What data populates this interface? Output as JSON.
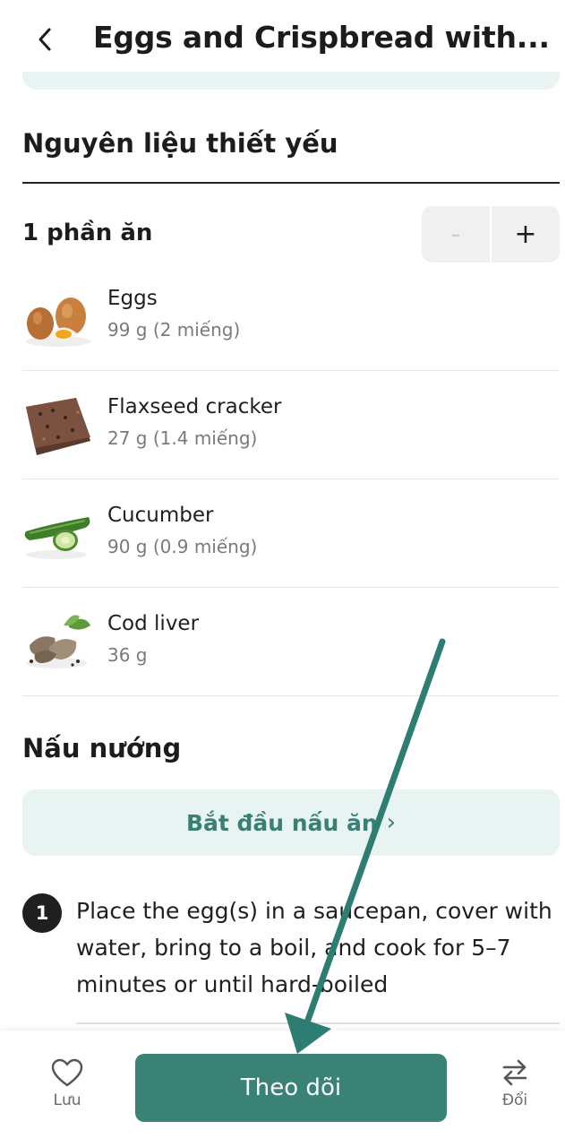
{
  "header": {
    "title": "Eggs and Crispbread with..."
  },
  "ingredients_section": {
    "title": "Nguyên liệu thiết yếu",
    "servings_label": "1 phần ăn",
    "minus_label": "-",
    "plus_label": "+",
    "items": [
      {
        "name": "Eggs",
        "quantity": "99 g (2 miếng)",
        "icon": "eggs-image"
      },
      {
        "name": "Flaxseed cracker",
        "quantity": "27 g (1.4 miếng)",
        "icon": "cracker-image"
      },
      {
        "name": "Cucumber",
        "quantity": "90 g (0.9 miếng)",
        "icon": "cucumber-image"
      },
      {
        "name": "Cod liver",
        "quantity": "36 g",
        "icon": "cod-liver-image"
      }
    ]
  },
  "cooking_section": {
    "title": "Nấu nướng",
    "start_button_label": "Bắt đầu nấu ăn",
    "steps": [
      {
        "number": "1",
        "text": "Place the egg(s) in a saucepan, cover with water, bring to a boil, and cook for 5–7 minutes or until hard-boiled"
      }
    ]
  },
  "bottom_bar": {
    "save_label": "Lưu",
    "follow_label": "Theo dõi",
    "swap_label": "Đổi"
  },
  "colors": {
    "accent": "#3a8275",
    "accent_light": "#e8f4f1",
    "annotation_arrow": "#2e7d72"
  }
}
